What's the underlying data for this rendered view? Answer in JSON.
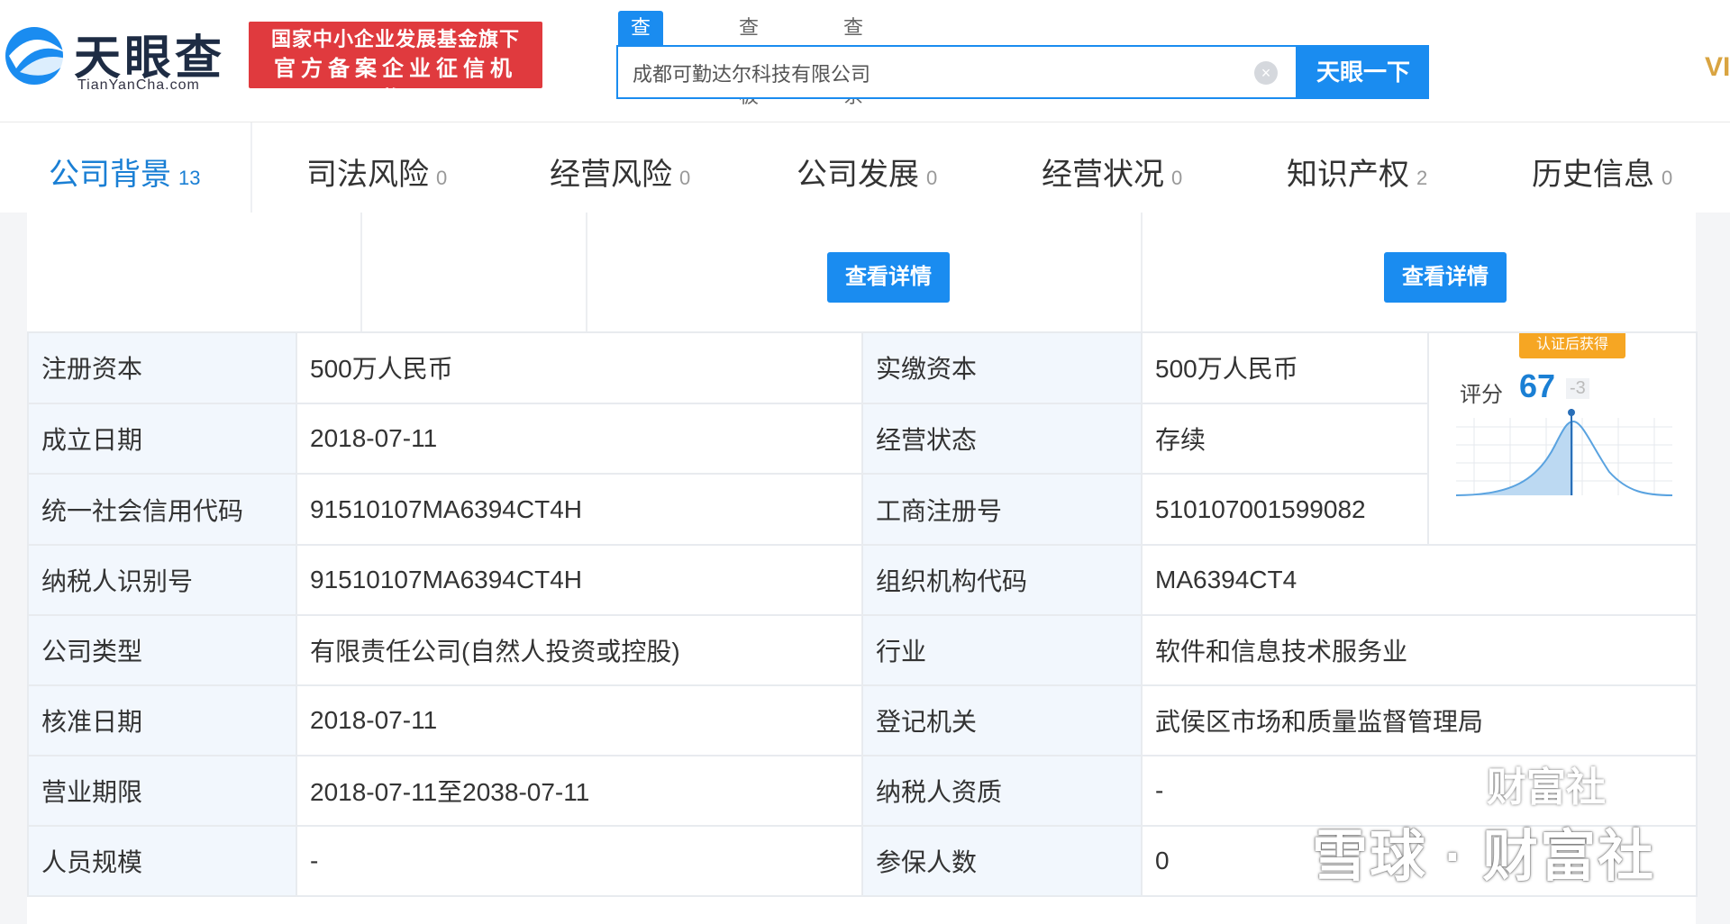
{
  "header": {
    "brand": "天眼查",
    "site": "TianYanCha.com",
    "badge_line1": "国家中小企业发展基金旗下",
    "badge_line2": "官方备案企业征信机构",
    "search_tabs": [
      "查公司",
      "查老板",
      "查关系"
    ],
    "search_value": "成都可勤达尔科技有限公司",
    "search_button": "天眼一下",
    "vip": "VI"
  },
  "nav": [
    {
      "label": "公司背景",
      "count": "13"
    },
    {
      "label": "司法风险",
      "count": "0"
    },
    {
      "label": "经营风险",
      "count": "0"
    },
    {
      "label": "公司发展",
      "count": "0"
    },
    {
      "label": "经营状况",
      "count": "0"
    },
    {
      "label": "知识产权",
      "count": "2"
    },
    {
      "label": "历史信息",
      "count": "0"
    }
  ],
  "detail_button": "查看详情",
  "score": {
    "tag": "认证后获得",
    "label": "评分",
    "value": "67",
    "delta": "-3"
  },
  "rows": [
    {
      "l1": "注册资本",
      "v1": "500万人民币",
      "l2": "实缴资本",
      "v2": "500万人民币"
    },
    {
      "l1": "成立日期",
      "v1": "2018-07-11",
      "l2": "经营状态",
      "v2": "存续"
    },
    {
      "l1": "统一社会信用代码",
      "v1": "91510107MA6394CT4H",
      "l2": "工商注册号",
      "v2": "510107001599082"
    },
    {
      "l1": "纳税人识别号",
      "v1": "91510107MA6394CT4H",
      "l2": "组织机构代码",
      "v2": "MA6394CT4"
    },
    {
      "l1": "公司类型",
      "v1": "有限责任公司(自然人投资或控股)",
      "l2": "行业",
      "v2": "软件和信息技术服务业"
    },
    {
      "l1": "核准日期",
      "v1": "2018-07-11",
      "l2": "登记机关",
      "v2": "武侯区市场和质量监督管理局"
    },
    {
      "l1": "营业期限",
      "v1": "2018-07-11至2038-07-11",
      "l2": "纳税人资质",
      "v2": "-"
    },
    {
      "l1": "人员规模",
      "v1": "-",
      "l2": "参保人数",
      "v2": "0"
    }
  ],
  "watermark": "雪球 · 财富社",
  "watermark_top": "财富社",
  "colors": {
    "accent": "#1a8cf0",
    "badge": "#e03a3e",
    "score_tag": "#f6a623",
    "label_bg": "#f2f7fd"
  }
}
